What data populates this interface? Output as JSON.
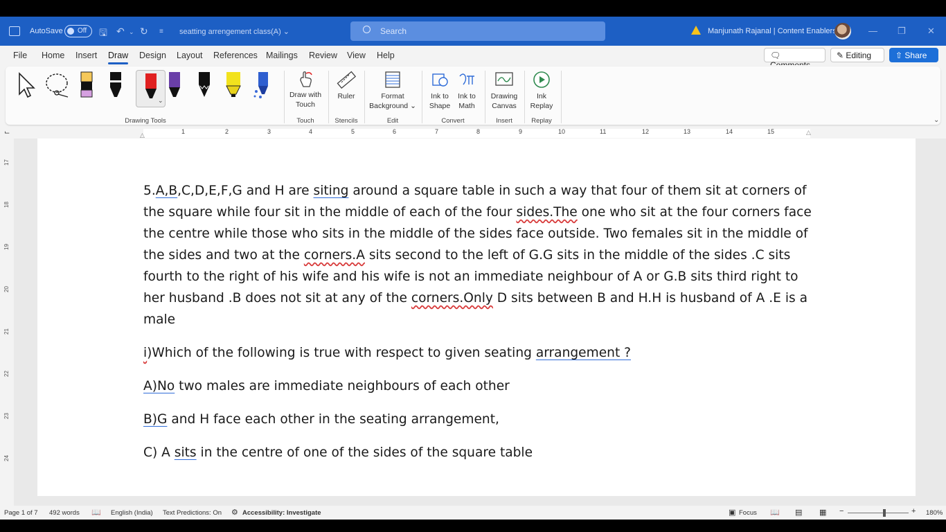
{
  "titlebar": {
    "autosave_label": "AutoSave",
    "autosave_state": "Off",
    "document_title": "seatting arrengement class(A)",
    "search_placeholder": "Search",
    "user_name": "Manjunath Rajanal | Content Enablers"
  },
  "tabs": [
    "File",
    "Home",
    "Insert",
    "Draw",
    "Design",
    "Layout",
    "References",
    "Mailings",
    "Review",
    "View",
    "Help"
  ],
  "active_tab": "Draw",
  "actions": {
    "comments": "Comments",
    "editing": "Editing",
    "share": "Share"
  },
  "ribbon": {
    "groups": {
      "drawing_tools": "Drawing Tools",
      "touch": "Touch",
      "stencils": "Stencils",
      "edit": "Edit",
      "convert": "Convert",
      "insert": "Insert",
      "replay": "Replay"
    },
    "buttons": {
      "draw_with_touch_1": "Draw with",
      "draw_with_touch_2": "Touch",
      "ruler": "Ruler",
      "format_bg_1": "Format",
      "format_bg_2": "Background",
      "ink_to_shape_1": "Ink to",
      "ink_to_shape_2": "Shape",
      "ink_to_math_1": "Ink to",
      "ink_to_math_2": "Math",
      "drawing_canvas_1": "Drawing",
      "drawing_canvas_2": "Canvas",
      "ink_replay_1": "Ink",
      "ink_replay_2": "Replay"
    }
  },
  "ruler_numbers": [
    "1",
    "2",
    "3",
    "4",
    "5",
    "6",
    "7",
    "8",
    "9",
    "10",
    "11",
    "12",
    "13",
    "14",
    "15"
  ],
  "vruler_numbers": [
    "17",
    "18",
    "19",
    "20",
    "21",
    "22",
    "23",
    "24"
  ],
  "document": {
    "para1": {
      "a": "5.",
      "b": "A,B",
      "c": ",C,D,E,F,G and H are ",
      "d": "siting",
      "e": " around a square table in such a way that four of them sit at corners of the square while four sit in the middle of each of the four ",
      "f": "sides.The",
      "g": " one who sit at the four corners face the centre while those who sits in the middle of the sides face outside. Two females sit in the middle of the sides and two at the ",
      "h": "corners.A",
      "i": " sits second to the left of G.G sits in the middle of the sides .C sits fourth to the right of his wife and his wife is not an immediate neighbour of A or G.B sits third right to her husband .B does not sit at any of the ",
      "j": "corners.Only",
      "k": " D sits between B and H.H is husband of A .E is a male"
    },
    "question": {
      "a": "i",
      "b": ")Which of the following is true with respect to given seating ",
      "c": "arrangement ?"
    },
    "optA": {
      "a": "A)No",
      "b": " two males are immediate neighbours of each other"
    },
    "optB": {
      "a": "B)G",
      "b": " and H face each other in the seating arrangement,"
    },
    "optC": {
      "a": "C) A ",
      "b": "sits",
      "c": " in the centre of one of the sides of the square table"
    }
  },
  "status": {
    "page": "Page 1 of 7",
    "words": "492 words",
    "language": "English (India)",
    "predictions": "Text Predictions: On",
    "accessibility": "Accessibility: Investigate",
    "focus": "Focus",
    "zoom": "180%"
  },
  "colors": {
    "titlebar": "#1d5fc4",
    "accent": "#1d6fd8",
    "ribbon_bg": "#f3f3f3"
  }
}
